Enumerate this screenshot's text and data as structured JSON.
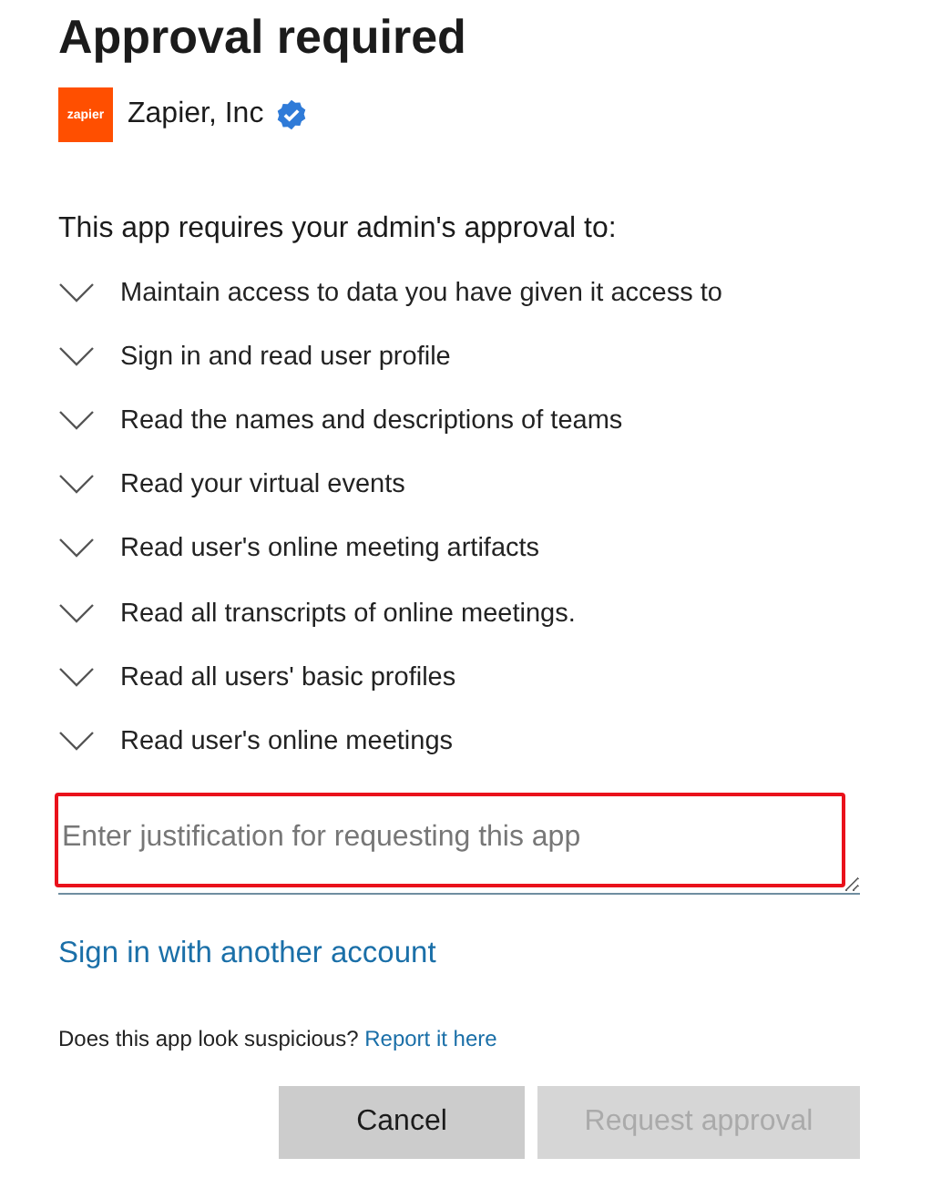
{
  "title": "Approval required",
  "app": {
    "logo_text": "zapier",
    "name": "Zapier, Inc",
    "verified": true
  },
  "intro": "This app requires your admin's approval to:",
  "permissions": [
    {
      "label": "Maintain access to data you have given it access to",
      "expanded": false
    },
    {
      "label": "Sign in and read user profile",
      "expanded": false
    },
    {
      "label": "Read the names and descriptions of teams",
      "expanded": false
    },
    {
      "label": "Read your virtual events",
      "expanded": false
    },
    {
      "label": "Read user's online meeting artifacts",
      "expanded": false
    },
    {
      "label": "Read all transcripts of online meetings.",
      "expanded": false
    },
    {
      "label": "Read all users' basic profiles",
      "expanded": false
    },
    {
      "label": "Read user's online meetings",
      "expanded": false
    }
  ],
  "justification": {
    "placeholder": "Enter justification for requesting this app",
    "highlighted": true
  },
  "switch_account": "Sign in with another account",
  "report": {
    "question": "Does this app look suspicious?",
    "link": "Report it here"
  },
  "buttons": [
    {
      "label": "Cancel",
      "disabled": false
    },
    {
      "label": "Request approval",
      "disabled": true
    }
  ]
}
